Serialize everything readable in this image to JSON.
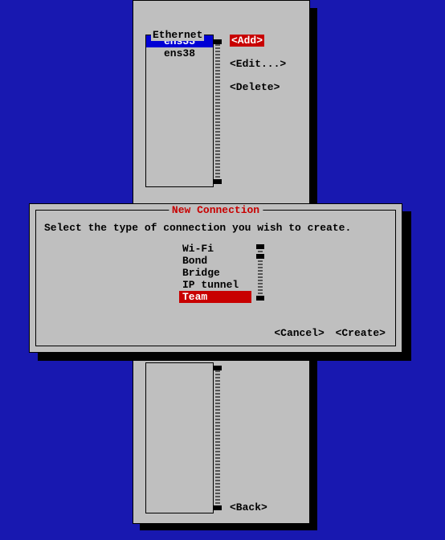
{
  "main": {
    "header": "Ethernet",
    "devices": [
      "ens33",
      "ens38"
    ],
    "selected_index": 0,
    "buttons": {
      "add": "<Add>",
      "edit": "<Edit...>",
      "delete": "<Delete>",
      "back": "<Back>"
    }
  },
  "dialog": {
    "title": " New Connection ",
    "prompt": "Select the type of connection you wish to create.",
    "types": [
      "Wi-Fi",
      "Bond",
      "Bridge",
      "IP tunnel",
      "Team"
    ],
    "selected_index": 4,
    "buttons": {
      "cancel": "<Cancel>",
      "create": "<Create>"
    }
  }
}
